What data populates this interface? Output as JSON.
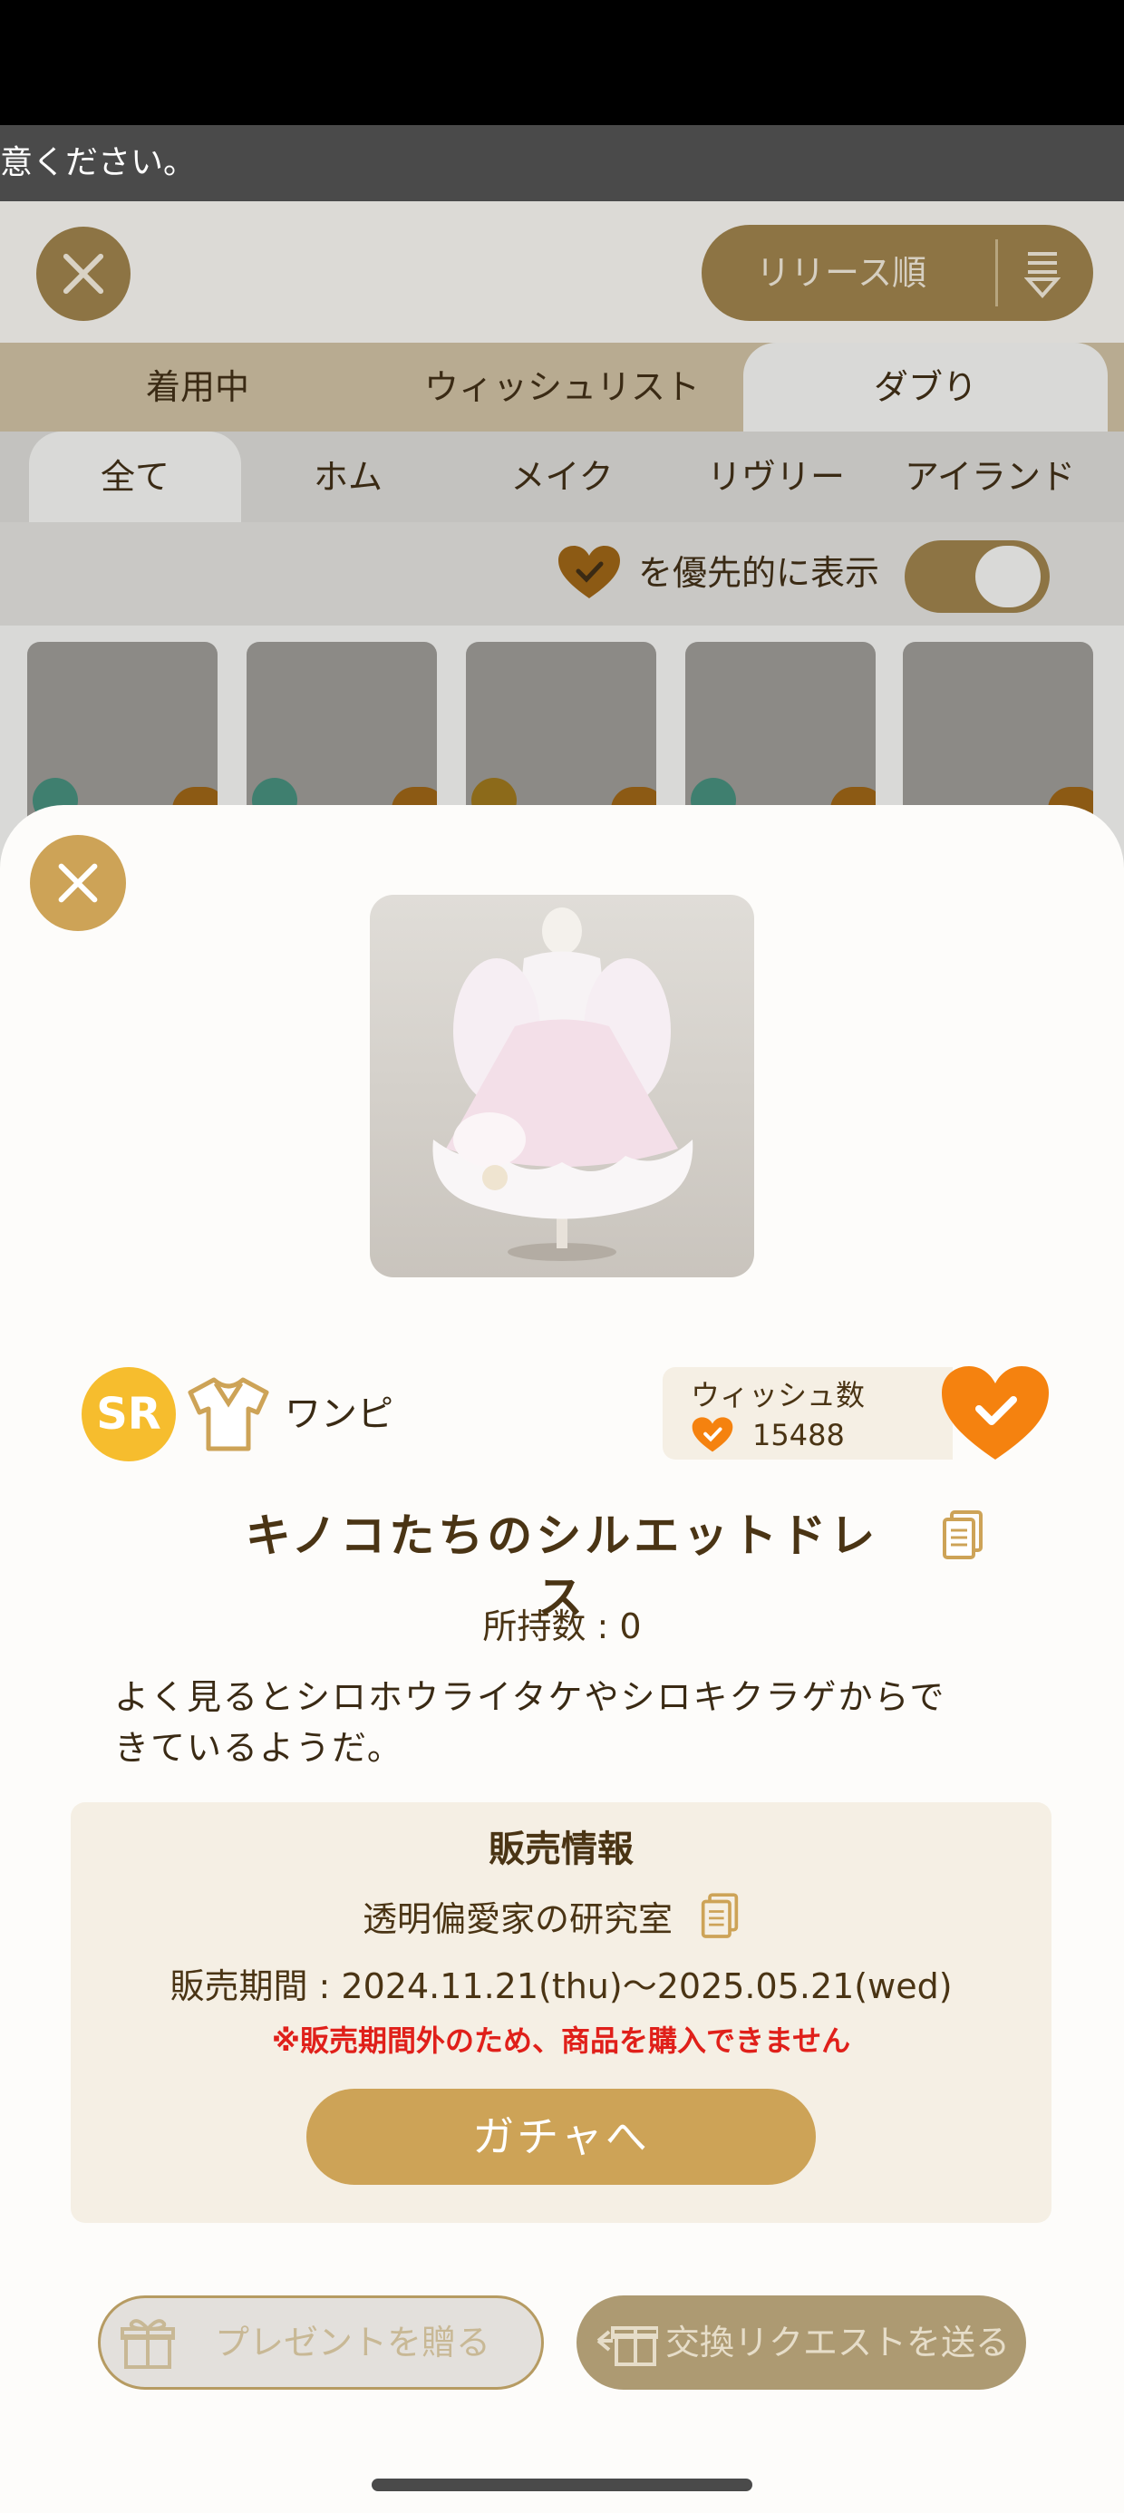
{
  "notice": {
    "text": "意ください。"
  },
  "background_app": {
    "sort_label": "リリース順",
    "tabs": [
      {
        "label": "着用中",
        "active": false
      },
      {
        "label": "ウィッシュリスト",
        "active": false
      },
      {
        "label": "ダブり",
        "active": true
      }
    ],
    "subtabs": [
      {
        "label": "全て",
        "active": true
      },
      {
        "label": "ホム",
        "active": false
      },
      {
        "label": "メイク",
        "active": false
      },
      {
        "label": "リヴリー",
        "active": false
      },
      {
        "label": "アイランド",
        "active": false
      }
    ],
    "filter_label": "を優先的に表示",
    "filter_enabled": true
  },
  "item": {
    "rarity": "SR",
    "category": "ワンピ",
    "wish": {
      "title": "ウィッシュ数",
      "count": "15488",
      "wished": true
    },
    "name": "キノコたちのシルエットドレス",
    "owned": "所持数 : 0",
    "description": "よく見るとシロホウライタケやシロキクラゲからできているようだ。"
  },
  "sale": {
    "heading": "販売情報",
    "shop": "透明偏愛家の研究室",
    "period": "販売期間 : 2024.11.21(thu)〜2025.05.21(wed)",
    "warning": "※販売期間外のため、商品を購入できません",
    "gacha_button": "ガチャへ"
  },
  "actions": {
    "present": "プレゼントを贈る",
    "exchange": "交換リクエストを送る"
  },
  "colors": {
    "gold": "#cda357",
    "heart_orange": "#f5820f",
    "rarity_yellow": "#f6bd2e",
    "warning_red": "#e0201a",
    "text_brown": "#4a3414"
  }
}
